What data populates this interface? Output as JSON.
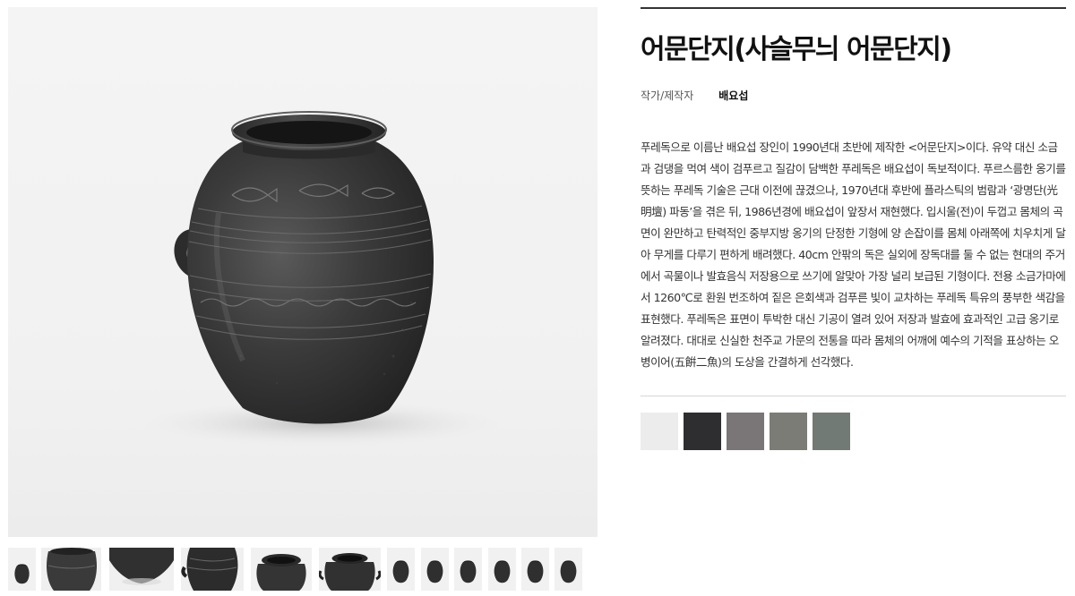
{
  "product": {
    "title": "어문단지(사슬무늬 어문단지)",
    "maker_label": "작가/제작자",
    "maker_value": "배요섭",
    "description": "푸레독으로 이름난 배요섭 장인이 1990년대 초반에 제작한 <어문단지>이다. 유약 대신 소금과 검댕을 먹여 색이 검푸르고 질감이 담백한 푸레독은 배요섭이 독보적이다. 푸르스름한 옹기를 뜻하는 푸레독 기술은 근대 이전에 끊겼으나, 1970년대 후반에 플라스틱의 범람과 ‘광명단(光明壇) 파동’을 겪은 뒤, 1986년경에 배요섭이 앞장서 재현했다. 입시울(전)이 두껍고 몸체의 곡면이 완만하고 탄력적인 중부지방 옹기의 단정한 기형에 양 손잡이를 몸체 아래쪽에 치우치게 달아 무게를 다루기 편하게 배려했다. 40cm 안팎의 독은 실외에 장독대를 둘 수 없는 현대의 주거에서 곡물이나 발효음식 저장용으로 쓰기에 알맞아 가장 널리 보급된 기형이다. 전용 소금가마에서 1260℃로 환원 번조하여 짙은 은회색과 검푸른 빛이 교차하는 푸레독 특유의 풍부한 색감을 표현했다. 푸레독은 표면이 투박한 대신 기공이 열려 있어 저장과 발효에 효과적인 고급 옹기로 알려졌다. 대대로 신실한 천주교 가문의 전통을 따라 몸체의 어깨에 예수의 기적을 표상하는 오병이어(五餠二魚)의 도상을 간결하게 선각했다."
  },
  "color_swatches": [
    "#ececec",
    "#2e2e30",
    "#7a7576",
    "#7c7c77",
    "#717a75"
  ],
  "gallery": {
    "main_image_icon": "jar-photo",
    "thumbnails": [
      {
        "icon": "jar-small-icon",
        "view": "full"
      },
      {
        "icon": "jar-closeup-icon",
        "view": "closeup"
      },
      {
        "icon": "jar-bottom-icon",
        "view": "bottom"
      },
      {
        "icon": "jar-handle-icon",
        "view": "handle"
      },
      {
        "icon": "jar-rim-icon",
        "view": "rim"
      },
      {
        "icon": "jar-top-icon",
        "view": "top"
      },
      {
        "icon": "jar-small-icon",
        "view": "full"
      },
      {
        "icon": "jar-small-icon",
        "view": "full"
      },
      {
        "icon": "jar-small-icon",
        "view": "full"
      },
      {
        "icon": "jar-small-icon",
        "view": "full"
      },
      {
        "icon": "jar-small-icon",
        "view": "full"
      },
      {
        "icon": "jar-small-icon",
        "view": "full"
      }
    ]
  }
}
